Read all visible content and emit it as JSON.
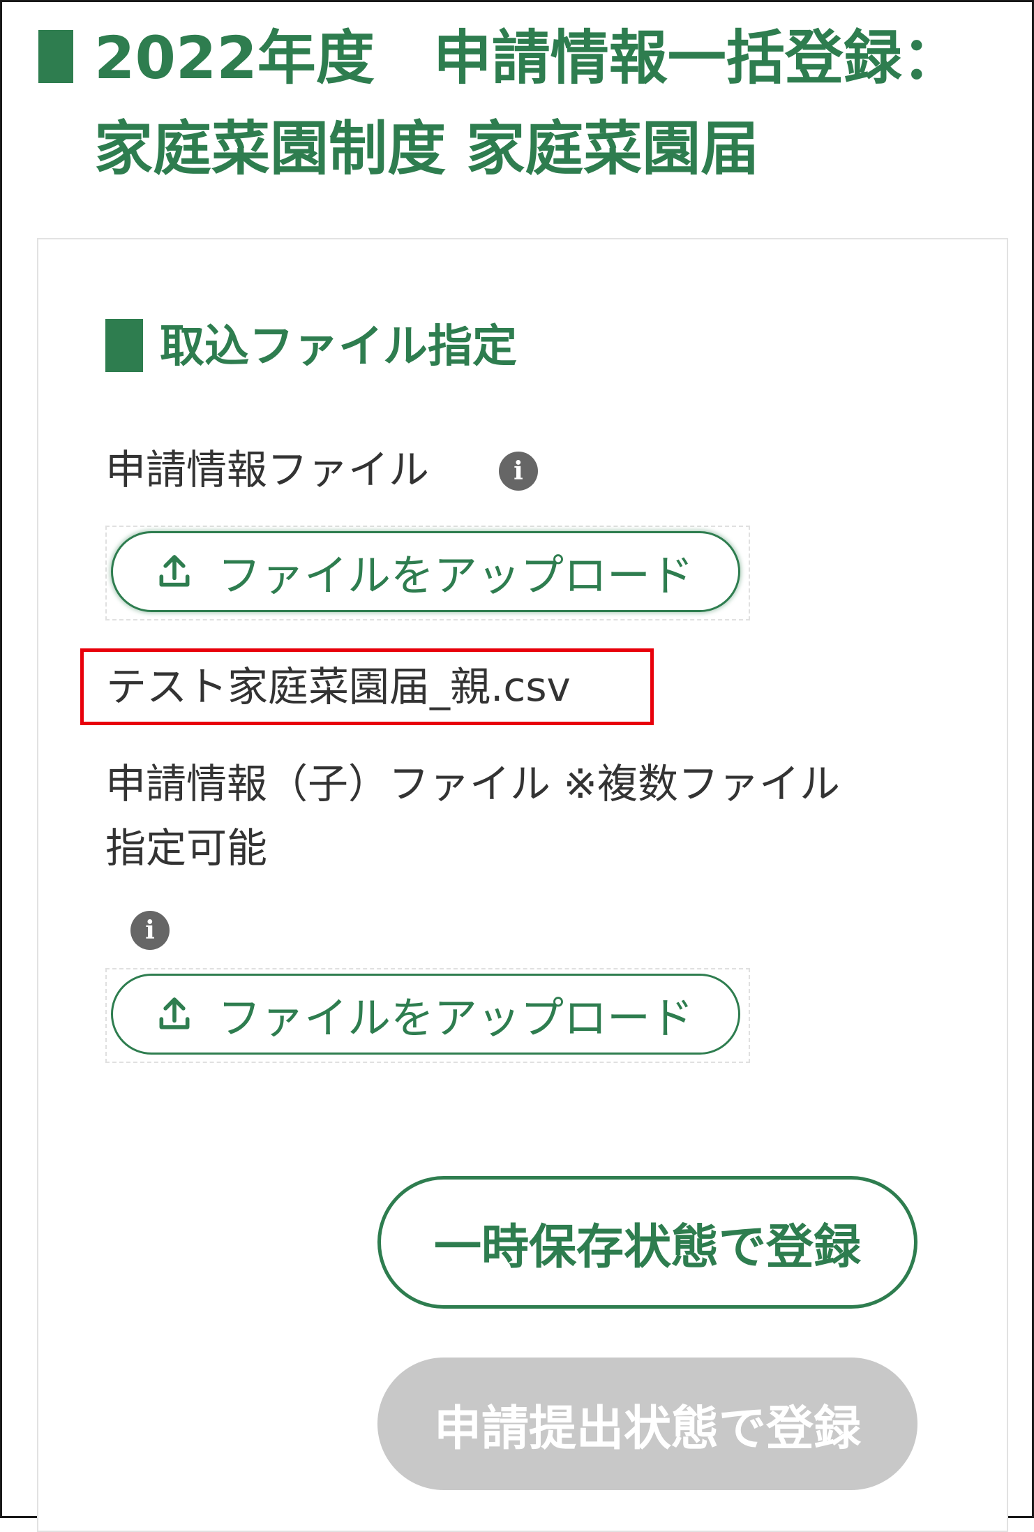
{
  "page": {
    "title_line1": "2022年度　申請情報一括登録：",
    "title_line2": "家庭菜園制度 家庭菜園届"
  },
  "import_section": {
    "title": "取込ファイル指定",
    "parent_file": {
      "label": "申請情報ファイル",
      "info_icon": "info-icon",
      "upload_label": "ファイルをアップロード",
      "selected_file": "テスト家庭菜園届_親.csv"
    },
    "child_file": {
      "label_line1": "申請情報（子）ファイル ※複数ファイル",
      "label_line2": "指定可能",
      "info_icon": "info-icon",
      "upload_label": "ファイルをアップロード"
    }
  },
  "actions": {
    "temp_save_label": "一時保存状態で登録",
    "submit_label": "申請提出状態で登録",
    "submit_enabled": false
  },
  "colors": {
    "accent": "#2e7d4f",
    "highlight_border": "#e8000b",
    "disabled": "#c8c8c8"
  }
}
